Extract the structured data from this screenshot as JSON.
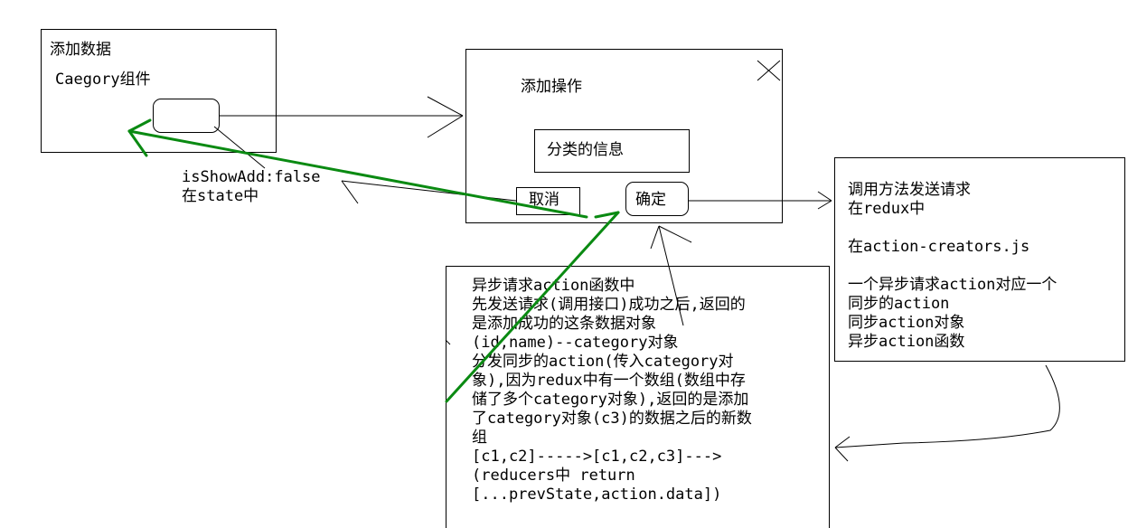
{
  "left_panel": {
    "title": "添加数据",
    "component_label": "Caegory组件"
  },
  "state_note": {
    "line1": "isShowAdd:false",
    "line2": "在state中"
  },
  "dialog": {
    "title": "添加操作",
    "field_label": "分类的信息",
    "cancel_label": "取消",
    "confirm_label": "确定"
  },
  "redux_note": {
    "lines": [
      "调用方法发送请求",
      "在redux中",
      "",
      "在action-creators.js",
      "",
      "一个异步请求action对应一个",
      "同步的action",
      "同步action对象",
      "异步action函数"
    ]
  },
  "async_note": {
    "lines": [
      "异步请求action函数中",
      "先发送请求(调用接口)成功之后,返回的",
      "是添加成功的这条数据对象",
      "(id,name)--category对象",
      "分发同步的action(传入category对",
      "象),因为redux中有一个数组(数组中存",
      "储了多个category对象),返回的是添加",
      "了category对象(c3)的数据之后的新数",
      "组",
      "[c1,c2]----->[c1,c2,c3]--->",
      "(reducers中  return",
      "[...prevState,action.data])"
    ]
  },
  "colors": {
    "arrow_green": "#0a8a12",
    "line_black": "#000000"
  }
}
